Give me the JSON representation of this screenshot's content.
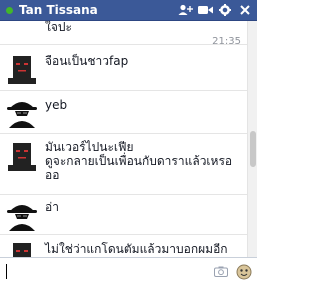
{
  "titlebar": {
    "name": "Tan Tissana",
    "icons": [
      "add-friend-icon",
      "video-call-icon",
      "gear-icon",
      "close-icon"
    ]
  },
  "messages": [
    {
      "text": "ใจปะ",
      "timestamp": "21:35",
      "avatar": ""
    },
    {
      "text": "จือนเป็นชาวfap",
      "avatar": "face-avatar"
    },
    {
      "text": "yeb",
      "avatar": "hat-avatar"
    },
    {
      "text": "มันเวอร์ไปนะเฟีย\nดูจะกลายเป็นเพื่อนกับดาราแล้วเหรอ\nออ",
      "avatar": "face-avatar"
    },
    {
      "text": "อ่า",
      "avatar": "hat-avatar"
    },
    {
      "text": "ไม่ใช่ว่าแกโดนตัมแล้วมาบอกผมอีก",
      "avatar": "face-avatar"
    }
  ],
  "composer": {
    "value": "",
    "placeholder": ""
  },
  "colors": {
    "header": "#3b5998",
    "online": "#42b72a"
  }
}
